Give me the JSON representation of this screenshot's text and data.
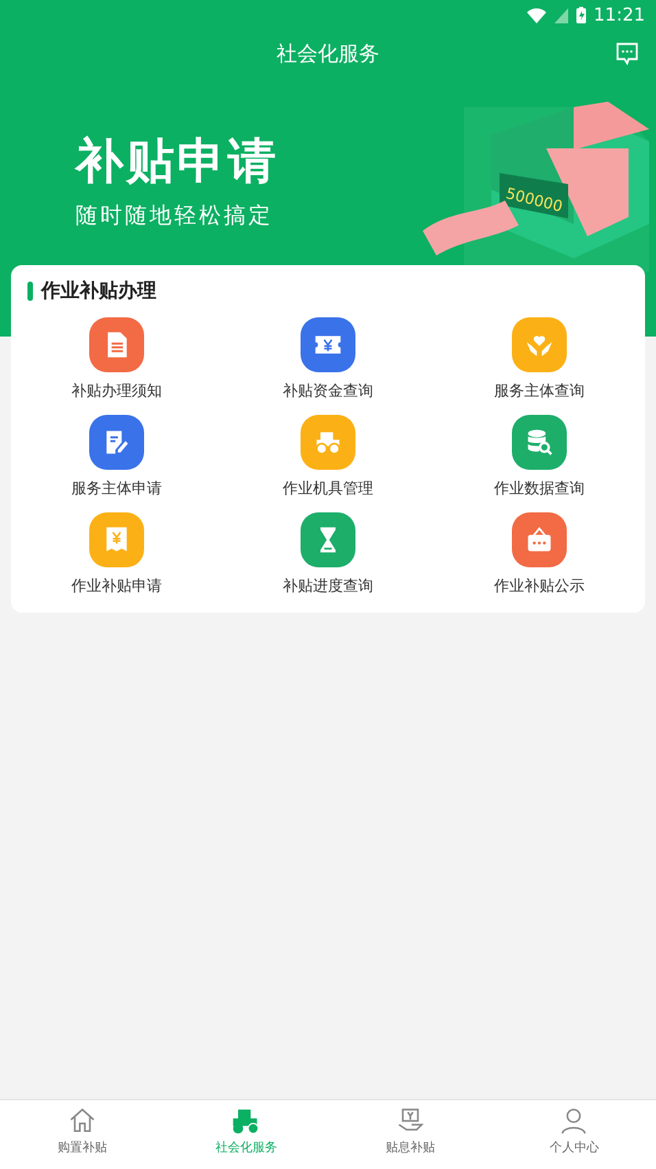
{
  "status_bar": {
    "time": "11:21"
  },
  "header": {
    "title": "社会化服务"
  },
  "banner": {
    "title": "补贴申请",
    "subtitle": "随时随地轻松搞定",
    "counter": "500000"
  },
  "section": {
    "title": "作业补贴办理",
    "items": [
      {
        "label": "补贴办理须知",
        "kind": "document",
        "color": "#f26b45"
      },
      {
        "label": "补贴资金查询",
        "kind": "ticket",
        "color": "#3a72ea"
      },
      {
        "label": "服务主体查询",
        "kind": "heart",
        "color": "#fbb116"
      },
      {
        "label": "服务主体申请",
        "kind": "edit",
        "color": "#3a72ea"
      },
      {
        "label": "作业机具管理",
        "kind": "tractor",
        "color": "#fbb116"
      },
      {
        "label": "作业数据查询",
        "kind": "database",
        "color": "#1dae6a"
      },
      {
        "label": "作业补贴申请",
        "kind": "receipt",
        "color": "#fbb116"
      },
      {
        "label": "补贴进度查询",
        "kind": "hourglass",
        "color": "#1dae6a"
      },
      {
        "label": "作业补贴公示",
        "kind": "sign",
        "color": "#f26b45"
      }
    ]
  },
  "tab_bar": [
    {
      "label": "购置补贴",
      "kind": "home",
      "selected": false
    },
    {
      "label": "社会化服务",
      "kind": "tractor",
      "selected": true
    },
    {
      "label": "贴息补贴",
      "kind": "loan",
      "selected": false
    },
    {
      "label": "个人中心",
      "kind": "person",
      "selected": false
    }
  ]
}
